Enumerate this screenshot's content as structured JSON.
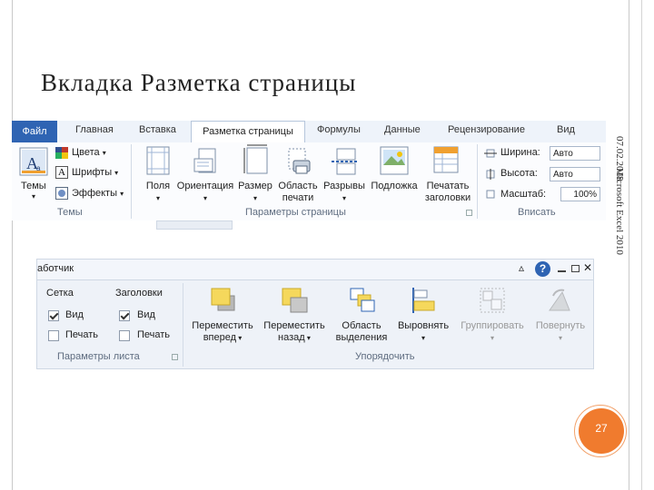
{
  "slide": {
    "title": "Вкладка Разметка страницы",
    "date": "07.02.2018",
    "caption": "Microsoft Excel 2010",
    "page_number": "27"
  },
  "ribbon_top": {
    "tabs": [
      "Файл",
      "Главная",
      "Вставка",
      "Разметка страницы",
      "Формулы",
      "Данные",
      "Рецензирование",
      "Вид"
    ],
    "active_tab": "Разметка страницы",
    "themes": {
      "big_button": "Темы",
      "colors": "Цвета",
      "fonts": "Шрифты",
      "effects": "Эффекты",
      "group_label": "Темы"
    },
    "page_setup": {
      "buttons": [
        {
          "line1": "Поля",
          "line2": ""
        },
        {
          "line1": "Ориентация",
          "line2": ""
        },
        {
          "line1": "Размер",
          "line2": ""
        },
        {
          "line1": "Область",
          "line2": "печати"
        },
        {
          "line1": "Разрывы",
          "line2": ""
        },
        {
          "line1": "Подложка",
          "line2": ""
        },
        {
          "line1": "Печатать",
          "line2": "заголовки"
        }
      ],
      "group_label": "Параметры страницы"
    },
    "fit": {
      "width_label": "Ширина:",
      "width_value": "Авто",
      "height_label": "Высота:",
      "height_value": "Авто",
      "scale_label": "Масштаб:",
      "scale_value": "100%",
      "group_label": "Вписать"
    }
  },
  "ribbon_bottom": {
    "header_text": "аботчик",
    "sheet_options": {
      "col1_title": "Сетка",
      "col2_title": "Заголовки",
      "view_label": "Вид",
      "print_label": "Печать",
      "gridlines_view_checked": true,
      "headings_view_checked": true,
      "gridlines_print_checked": false,
      "headings_print_checked": false,
      "group_label": "Параметры листа"
    },
    "arrange": {
      "buttons": [
        {
          "line1": "Переместить",
          "line2": "вперед",
          "dropdown": true,
          "enabled": true
        },
        {
          "line1": "Переместить",
          "line2": "назад",
          "dropdown": true,
          "enabled": true
        },
        {
          "line1": "Область",
          "line2": "выделения",
          "dropdown": false,
          "enabled": true
        },
        {
          "line1": "Выровнять",
          "line2": "",
          "dropdown": true,
          "enabled": true
        },
        {
          "line1": "Группировать",
          "line2": "",
          "dropdown": true,
          "enabled": false
        },
        {
          "line1": "Повернуть",
          "line2": "",
          "dropdown": true,
          "enabled": false
        }
      ],
      "group_label": "Упорядочить"
    }
  },
  "colors": {
    "file_tab": "#2f64b3",
    "accent_orange": "#f07b2e",
    "shape_yellow": "#f5d85c"
  }
}
